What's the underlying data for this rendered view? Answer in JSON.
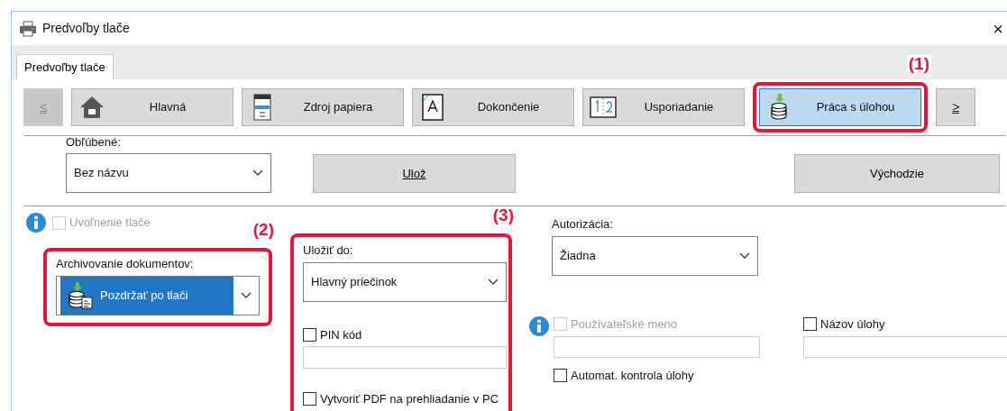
{
  "window": {
    "title": "Predvoľby tlače",
    "close": "×"
  },
  "tabs": [
    {
      "label": "Predvoľby tlače",
      "selected": true
    }
  ],
  "toolbar": {
    "prev": {
      "label": "≤",
      "disabled": true
    },
    "next": {
      "label": "≥",
      "disabled": false
    },
    "items": [
      {
        "kind": "home",
        "label": "Hlavná",
        "selected": false
      },
      {
        "kind": "paper",
        "label": "Zdroj papiera",
        "selected": false
      },
      {
        "kind": "finish",
        "label": "Dokončenie",
        "selected": false
      },
      {
        "kind": "layout",
        "label": "Usporiadanie",
        "selected": false
      },
      {
        "kind": "job",
        "label": "Práca s úlohou",
        "selected": true,
        "callout": "(1)"
      }
    ]
  },
  "favorites": {
    "label": "Obľúbené:",
    "value": "Bez názvu"
  },
  "save_button": "Ulož",
  "defaults_button": "Východzie",
  "release": {
    "label": "Uvoľnenie tlače",
    "checked": false,
    "disabled": true
  },
  "archiving": {
    "callout": "(2)",
    "label": "Archivovanie dokumentov:",
    "value": "Pozdržať po tlači"
  },
  "storage": {
    "callout": "(3)",
    "label": "Uložiť do:",
    "value": "Hlavný priečinok",
    "pin": {
      "label": "PIN kód",
      "checked": false,
      "disabled": false
    },
    "pdf": {
      "label": "Vytvoriť PDF na prehliadanie v PC",
      "checked": false,
      "disabled": false
    }
  },
  "authorization": {
    "label": "Autorizácia:",
    "value": "Žiadna"
  },
  "user_name": {
    "label": "Používateľské meno",
    "checked": false,
    "disabled": true
  },
  "job_name": {
    "label": "Názov úlohy",
    "checked": false,
    "disabled": false
  },
  "auto_check": {
    "label": "Automat. kontrola úlohy",
    "checked": false,
    "disabled": false
  }
}
